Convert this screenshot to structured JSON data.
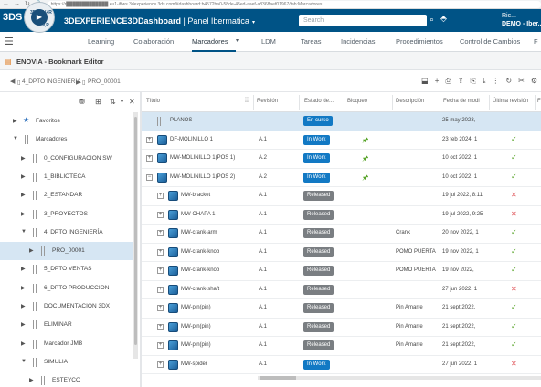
{
  "browser": {
    "url": "https://r█████████████.eu1-iftws.3dexperience.3ds.com/#dashboard:b4572ba0-58de-45ed-aaef-a8368aef01967/tab:Marcadores",
    "back_icon": "arrow-left",
    "forward_icon": "arrow-right",
    "reload_icon": "reload",
    "lock_icon": "lock"
  },
  "header": {
    "logo": "3DS",
    "compass": {
      "center": "▶",
      "q_top_left": "3D",
      "q_top_right": "V+R",
      "q_bottom_left": "",
      "q_bottom_right": "V,R"
    },
    "brand": "3DEXPERIENCE",
    "app": "3DDashboard",
    "separator": " | ",
    "dashboard": "Panel Ibermatica",
    "search_placeholder": "Search",
    "user": "Ric...",
    "tenant": "DEMO - Iber..."
  },
  "tabs": {
    "items": [
      {
        "label": "Learning"
      },
      {
        "label": "Colaboración"
      },
      {
        "label": "Marcadores"
      },
      {
        "label": "LDM"
      },
      {
        "label": "Tareas"
      },
      {
        "label": "Incidencias"
      },
      {
        "label": "Procedimientos"
      },
      {
        "label": "Control de Cambios"
      },
      {
        "label": "F"
      }
    ],
    "active_index": 2
  },
  "app": {
    "title": "ENOVIA - Bookmark Editor"
  },
  "breadcrumb": {
    "items": [
      "4_DPTO INGENIERÍA",
      "PRO_00001"
    ]
  },
  "tree": {
    "items": [
      {
        "label": "Favoritos",
        "type": "star",
        "level": 0,
        "toggle": "▶"
      },
      {
        "label": "Marcadores",
        "type": "folder",
        "level": 0,
        "toggle": "▼"
      },
      {
        "label": "0_CONFIGURACION SW",
        "type": "folder",
        "level": 1,
        "toggle": "▶"
      },
      {
        "label": "1_BIBLIOTECA",
        "type": "folder",
        "level": 1,
        "toggle": "▶"
      },
      {
        "label": "2_ESTANDAR",
        "type": "folder",
        "level": 1,
        "toggle": "▶"
      },
      {
        "label": "3_PROYECTOS",
        "type": "folder",
        "level": 1,
        "toggle": "▶"
      },
      {
        "label": "4_DPTO INGENIERÍA",
        "type": "folder",
        "level": 1,
        "toggle": "▼"
      },
      {
        "label": "PRO_00001",
        "type": "folder",
        "level": 2,
        "toggle": "▶",
        "selected": true
      },
      {
        "label": "5_DPTO VENTAS",
        "type": "folder",
        "level": 1,
        "toggle": "▶"
      },
      {
        "label": "6_DPTO PRODUCCION",
        "type": "folder",
        "level": 1,
        "toggle": "▶"
      },
      {
        "label": "DOCUMENTACION 3DX",
        "type": "folder",
        "level": 1,
        "toggle": "▶"
      },
      {
        "label": "ELIMINAR",
        "type": "folder",
        "level": 1,
        "toggle": "▶"
      },
      {
        "label": "Marcador JMB",
        "type": "folder",
        "level": 1,
        "toggle": "▶"
      },
      {
        "label": "SIMULIA",
        "type": "folder",
        "level": 1,
        "toggle": "▼"
      },
      {
        "label": "ESTEYCO",
        "type": "folder",
        "level": 2,
        "toggle": "▶"
      }
    ]
  },
  "grid": {
    "columns": [
      "Título",
      "Revisión",
      "Estado de...",
      "Bloqueo",
      "Descripción",
      "Fecha de modi",
      "Última revisión",
      "F"
    ],
    "rows": [
      {
        "title": "PLANOS",
        "kind": "folder",
        "expander": "",
        "rev": "",
        "state": "En curso",
        "state_color": "blue",
        "lock": false,
        "desc": "",
        "date": "25 may 2023,",
        "last": "",
        "selected": true,
        "indent": 0
      },
      {
        "title": "DF-MOLINILLO 1",
        "kind": "part",
        "expander": "+",
        "rev": "A.1",
        "state": "In Work",
        "state_color": "blue",
        "lock": true,
        "desc": "",
        "date": "23 feb 2024, 1",
        "last": "ok",
        "indent": 0
      },
      {
        "title": "MW-MOLINILLO 1(POS 1)",
        "kind": "part",
        "expander": "+",
        "rev": "A.2",
        "state": "In Work",
        "state_color": "blue",
        "lock": true,
        "desc": "",
        "date": "10 oct 2022, 1",
        "last": "ok",
        "indent": 0
      },
      {
        "title": "MW-MOLINILLO 1(POS 2)",
        "kind": "part",
        "expander": "−",
        "rev": "A.2",
        "state": "In Work",
        "state_color": "blue",
        "lock": true,
        "desc": "",
        "date": "10 oct 2022, 1",
        "last": "ok",
        "indent": 0
      },
      {
        "title": "MW-bracket",
        "kind": "part",
        "expander": "+",
        "rev": "A.1",
        "state": "Released",
        "state_color": "gray",
        "lock": false,
        "desc": "",
        "date": "19 jul 2022, 8:11",
        "last": "bad",
        "indent": 1
      },
      {
        "title": "MW-CHAPA 1",
        "kind": "part",
        "expander": "+",
        "rev": "A.1",
        "state": "Released",
        "state_color": "gray",
        "lock": false,
        "desc": "",
        "date": "19 jul 2022, 9:25",
        "last": "bad",
        "indent": 1
      },
      {
        "title": "MW-crank-arm",
        "kind": "part",
        "expander": "+",
        "rev": "A.1",
        "state": "Released",
        "state_color": "gray",
        "lock": false,
        "desc": "Crank",
        "date": "20 nov 2022, 1",
        "last": "ok",
        "indent": 1
      },
      {
        "title": "MW-crank-knob",
        "kind": "part",
        "expander": "+",
        "rev": "A.1",
        "state": "Released",
        "state_color": "gray",
        "lock": false,
        "desc": "POMO PUERTA",
        "date": "19 nov 2022, 1",
        "last": "ok",
        "indent": 1
      },
      {
        "title": "MW-crank-knob",
        "kind": "part",
        "expander": "+",
        "rev": "A.1",
        "state": "Released",
        "state_color": "gray",
        "lock": false,
        "desc": "POMO PUERTA",
        "date": "19 nov 2022,",
        "last": "ok",
        "indent": 1
      },
      {
        "title": "MW-crank-shaft",
        "kind": "part",
        "expander": "+",
        "rev": "A.1",
        "state": "Released",
        "state_color": "gray",
        "lock": false,
        "desc": "",
        "date": "27 jun 2022, 1",
        "last": "bad",
        "indent": 1
      },
      {
        "title": "MW-pin(pin)",
        "kind": "part",
        "expander": "+",
        "rev": "A.1",
        "state": "Released",
        "state_color": "gray",
        "lock": false,
        "desc": "Pin Amarre",
        "date": "21 sept 2022,",
        "last": "ok",
        "indent": 1
      },
      {
        "title": "MW-pin(pin)",
        "kind": "part",
        "expander": "+",
        "rev": "A.1",
        "state": "Released",
        "state_color": "gray",
        "lock": false,
        "desc": "Pin Amarre",
        "date": "21 sept 2022,",
        "last": "ok",
        "indent": 1
      },
      {
        "title": "MW-pin(pin)",
        "kind": "part",
        "expander": "+",
        "rev": "A.1",
        "state": "Released",
        "state_color": "gray",
        "lock": false,
        "desc": "Pin Amarre",
        "date": "21 sept 2022,",
        "last": "ok",
        "indent": 1
      },
      {
        "title": "MW-spider",
        "kind": "part",
        "expander": "+",
        "rev": "A.1",
        "state": "In Work",
        "state_color": "blue",
        "lock": false,
        "desc": "",
        "date": "27 jun 2022, 1",
        "last": "bad",
        "indent": 1
      }
    ]
  },
  "colors": {
    "header_bg": "#005386",
    "selected_row": "#d6e6f3",
    "in_work": "#1279c4",
    "released": "#7a7e82",
    "ok_check": "#57a428",
    "error_x": "#e0555a"
  }
}
